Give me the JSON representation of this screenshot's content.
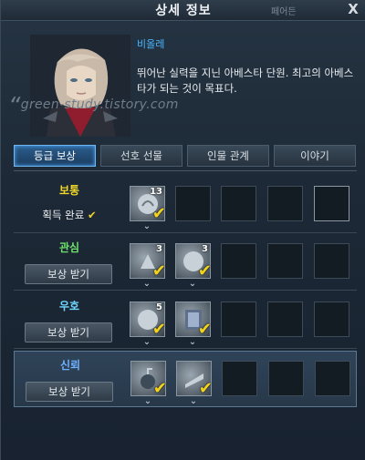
{
  "window": {
    "title": "상세 정보",
    "background_tab": "페어든",
    "close_label": "X"
  },
  "character": {
    "name": "비올레",
    "description": "뛰어난 실력을 지닌 아베스타 단원. 최고의 아베스타가 되는 것이 목표다."
  },
  "watermark": "green-study.tistory.com",
  "tabs": [
    {
      "label": "등급 보상",
      "active": true
    },
    {
      "label": "선호 선물",
      "active": false
    },
    {
      "label": "인물 관계",
      "active": false
    },
    {
      "label": "이야기",
      "active": false
    }
  ],
  "rows": [
    {
      "level": "보통",
      "level_color": "#f1d72a",
      "status": "획득 완료",
      "status_check": "✔",
      "button": null,
      "rewards": [
        {
          "count": "13",
          "checked": true
        }
      ]
    },
    {
      "level": "관심",
      "level_color": "#6fe06b",
      "status": null,
      "button": "보상 받기",
      "rewards": [
        {
          "count": "3",
          "checked": true
        },
        {
          "count": "3",
          "checked": true
        }
      ]
    },
    {
      "level": "우호",
      "level_color": "#6fd7ff",
      "status": null,
      "button": "보상 받기",
      "rewards": [
        {
          "count": "5",
          "checked": true
        },
        {
          "count": "",
          "checked": true
        }
      ]
    },
    {
      "level": "신뢰",
      "level_color": "#6fb1ff",
      "status": null,
      "button": "보상 받기",
      "rewards": [
        {
          "count": "",
          "checked": true
        },
        {
          "count": "",
          "checked": true
        }
      ]
    }
  ],
  "colors": {
    "accent": "#4ab6ff",
    "check": "#f3d41c"
  },
  "icons": {
    "close": "close-icon",
    "check": "check-icon",
    "reward_item": "reward-item-icon",
    "expand_marker": "chevron-marker-icon"
  }
}
